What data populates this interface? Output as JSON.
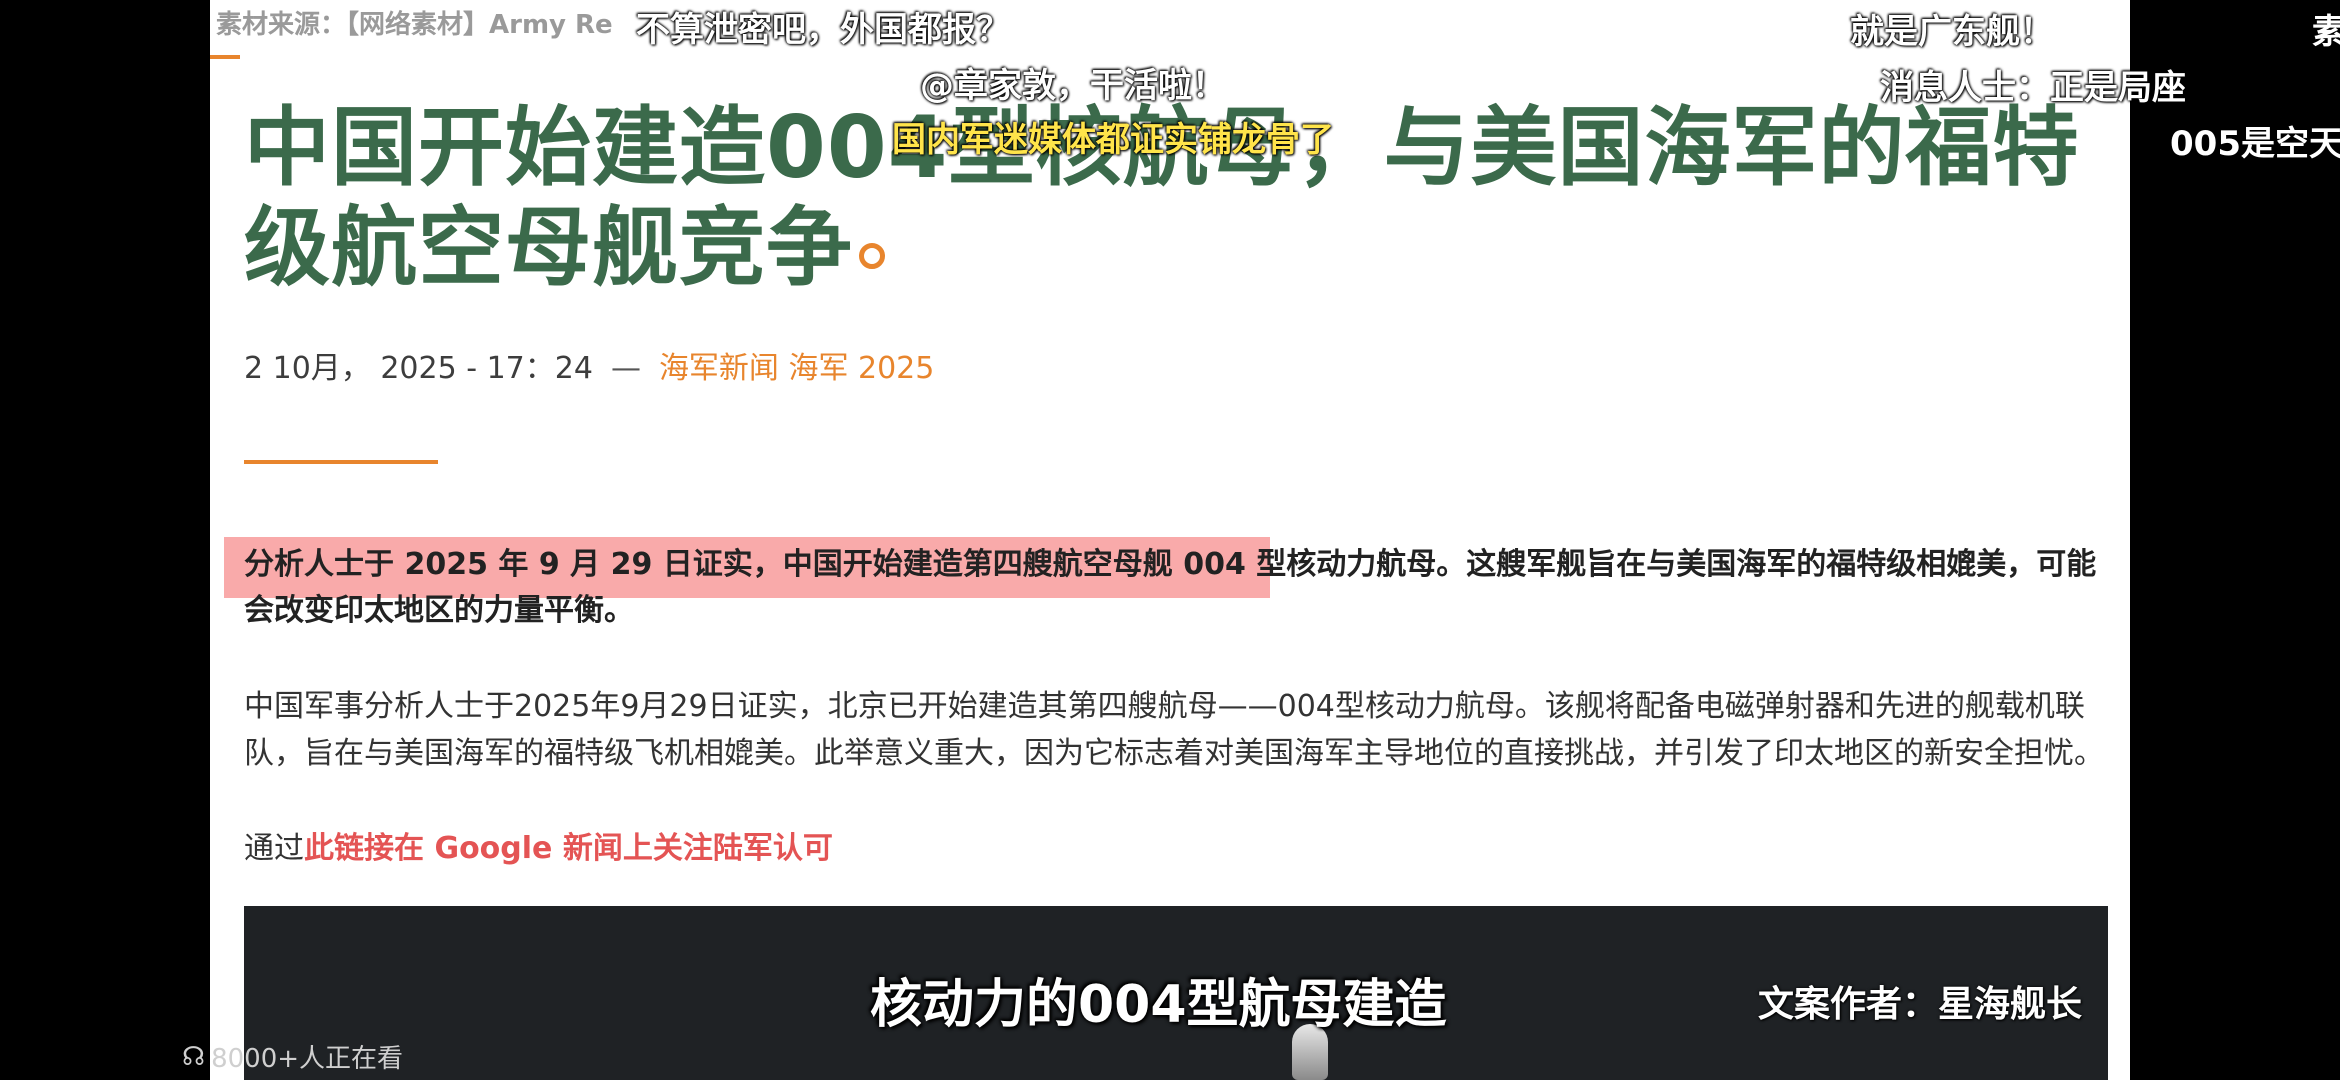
{
  "source_label": "素材来源：【网络素材】Army Re",
  "article": {
    "title": "中国开始建造004型核航母，与美国海军的福特级航空母舰竞争",
    "meta": {
      "date": "2 10月， 2025 - 17：24",
      "separator": "—",
      "categories": "海军新闻 海军 2025"
    },
    "lead": "分析人士于 2025 年 9 月 29 日证实，中国开始建造第四艘航空母舰 004 型核动力航母。这艘军舰旨在与美国海军的福特级相媲美，可能会改变印太地区的力量平衡。",
    "body": "中国军事分析人士于2025年9月29日证实，北京已开始建造其第四艘航母——004型核动力航母。该舰将配备电磁弹射器和先进的舰载机联队，旨在与美国海军的福特级飞机相媲美。此举意义重大，因为它标志着对美国海军主导地位的直接挑战，并引发了印太地区的新安全担忧。",
    "follow_prefix": "通过",
    "follow_link": "此链接在 Google 新闻上关注陆军认可"
  },
  "danmaku": [
    {
      "text": "不算泄密吧，外国都报？",
      "color": "white"
    },
    {
      "text": "@章家敦，干活啦！",
      "color": "white"
    },
    {
      "text": "国内军迷媒体都证实铺龙骨了",
      "color": "yellow"
    },
    {
      "text": "就是广东舰！",
      "color": "white"
    },
    {
      "text": "消息人士：正是局座",
      "color": "white"
    },
    {
      "text": "005是空天",
      "color": "white"
    },
    {
      "text": "素",
      "color": "white"
    }
  ],
  "caption": "核动力的004型航母建造",
  "author": "文案作者：星海舰长",
  "viewers": "8000+人正在看",
  "colors": {
    "title_green": "#3b6a4b",
    "accent_orange": "#e8852d",
    "highlight_pink": "#f9aaaa",
    "link_red": "#e45454"
  }
}
